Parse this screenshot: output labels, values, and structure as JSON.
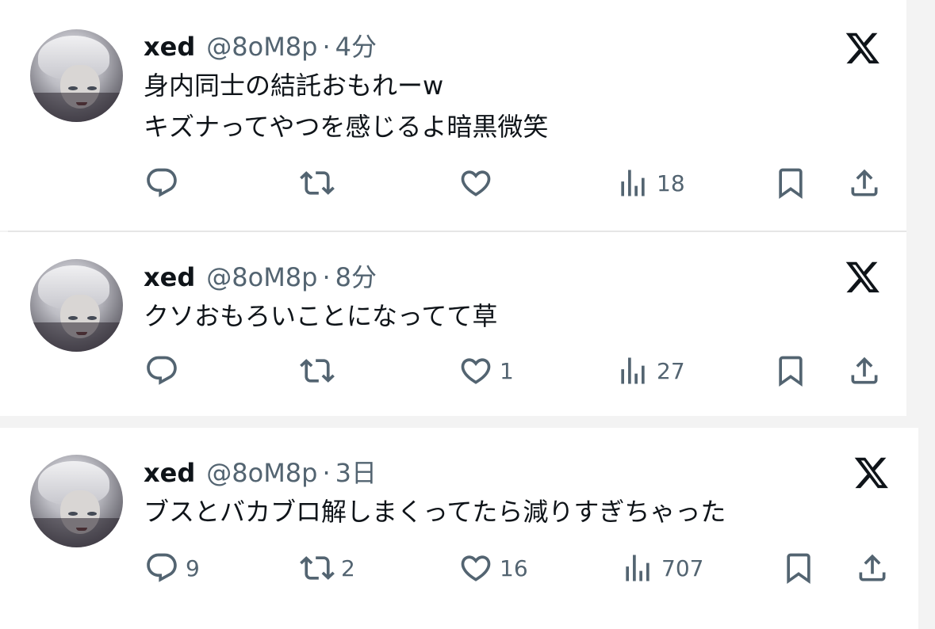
{
  "tweets": [
    {
      "name": "xed",
      "handle": "@8oM8p",
      "separator": "·",
      "time": "4分",
      "text": "身内同士の結託おもれーw\nキズナってやつを感じるよ暗黒微笑",
      "replies": "",
      "retweets": "",
      "likes": "",
      "views": "18"
    },
    {
      "name": "xed",
      "handle": "@8oM8p",
      "separator": "·",
      "time": "8分",
      "text": "クソおもろいことになってて草",
      "replies": "",
      "retweets": "",
      "likes": "1",
      "views": "27"
    },
    {
      "name": "xed",
      "handle": "@8oM8p",
      "separator": "·",
      "time": "3日",
      "text": "ブスとバカブロ解しまくってたら減りすぎちゃった",
      "replies": "9",
      "retweets": "2",
      "likes": "16",
      "views": "707"
    }
  ],
  "icons": {
    "reply": "reply-icon",
    "retweet": "retweet-icon",
    "like": "heart-icon",
    "views": "views-bar-chart-icon",
    "bookmark": "bookmark-icon",
    "share": "share-icon",
    "platform": "x-logo-icon"
  },
  "colors": {
    "text": "#0f1419",
    "secondary": "#536471",
    "background": "#ffffff"
  }
}
